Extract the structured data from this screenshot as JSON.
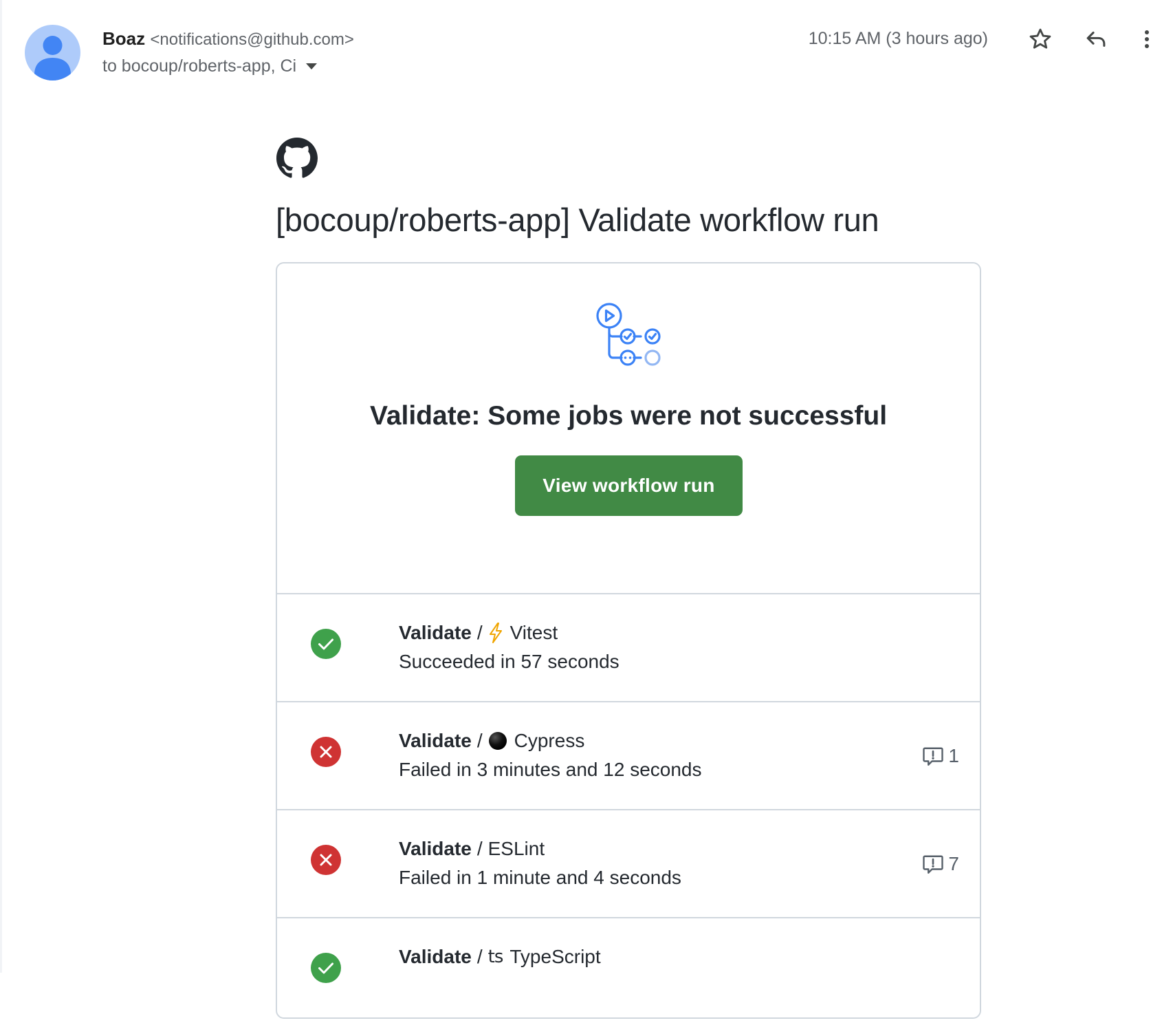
{
  "email": {
    "sender_name": "Boaz",
    "sender_email": "<notifications@github.com>",
    "recipients": "to bocoup/roberts-app, Ci",
    "timestamp": "10:15 AM (3 hours ago)",
    "icons": [
      "avatar-icon",
      "star-icon",
      "reply-icon",
      "more-vert-icon"
    ]
  },
  "body": {
    "logo": "github-logo",
    "title": "[bocoup/roberts-app] Validate workflow run",
    "card": {
      "icon": "workflow-icon",
      "heading": "Validate: Some jobs were not successful",
      "button_label": "View workflow run",
      "button_color": "#418a45",
      "jobs": [
        {
          "status": "success",
          "workflow": "Validate",
          "separator": "/",
          "emoji": "lightning-emoji",
          "name": "Vitest",
          "description": "Succeeded in 57 seconds",
          "annotations": ""
        },
        {
          "status": "failure",
          "workflow": "Validate",
          "separator": "/",
          "emoji": "black-circle-emoji",
          "name": "Cypress",
          "description": "Failed in 3 minutes and 12 seconds",
          "annotations": "1"
        },
        {
          "status": "failure",
          "workflow": "Validate",
          "separator": "/",
          "emoji": "",
          "name": "ESLint",
          "description": "Failed in 1 minute and 4 seconds",
          "annotations": "7"
        },
        {
          "status": "success",
          "workflow": "Validate",
          "separator": "/",
          "emoji": "ts",
          "name": "TypeScript",
          "description": "",
          "annotations": ""
        }
      ]
    },
    "colors": {
      "success": "#3fa14b",
      "failure": "#cf3333",
      "accent_blue": "#3b82f6"
    }
  }
}
